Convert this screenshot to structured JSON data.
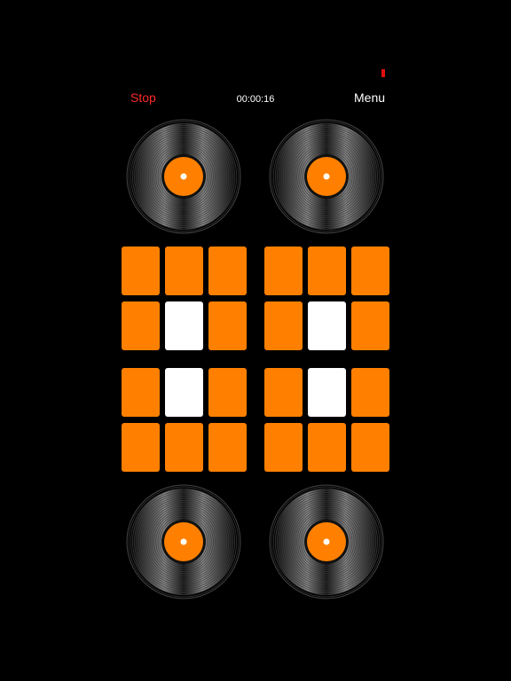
{
  "status": {
    "battery_color": "#e01010"
  },
  "header": {
    "stop_label": "Stop",
    "timer": "00:00:16",
    "menu_label": "Menu"
  },
  "colors": {
    "accent": "#ff8000",
    "pad_active": "#ffffff",
    "stop": "#ff2a2a"
  },
  "turntables": [
    {
      "name": "turntable-top-left"
    },
    {
      "name": "turntable-top-right"
    },
    {
      "name": "turntable-bottom-left"
    },
    {
      "name": "turntable-bottom-right"
    }
  ],
  "pad_banks": [
    {
      "name": "top-left",
      "active": [
        false,
        false,
        false,
        false,
        true,
        false
      ]
    },
    {
      "name": "top-right",
      "active": [
        false,
        false,
        false,
        false,
        true,
        false
      ]
    },
    {
      "name": "bottom-left",
      "active": [
        false,
        true,
        false,
        false,
        false,
        false
      ]
    },
    {
      "name": "bottom-right",
      "active": [
        false,
        true,
        false,
        false,
        false,
        false
      ]
    }
  ]
}
